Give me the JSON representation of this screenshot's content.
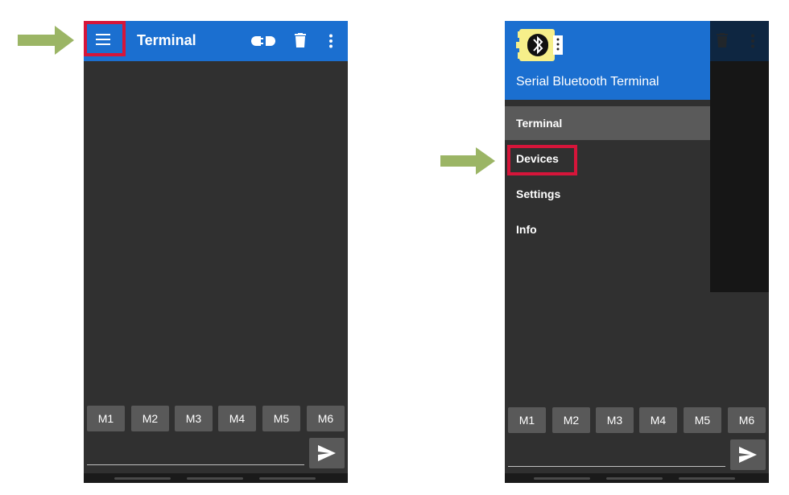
{
  "left_screen": {
    "appbar": {
      "title": "Terminal",
      "menu_icon": "hamburger-menu-icon",
      "connect_icon": "connect-icon",
      "delete_icon": "trash-icon",
      "overflow_icon": "more-vert-icon"
    },
    "macros": [
      "M1",
      "M2",
      "M3",
      "M4",
      "M5",
      "M6"
    ],
    "send_icon": "send-icon"
  },
  "right_screen": {
    "drawer": {
      "app_name": "Serial Bluetooth Terminal",
      "logo_icon": "bluetooth-serial-logo-icon",
      "items": [
        {
          "label": "Terminal",
          "active": true
        },
        {
          "label": "Devices",
          "active": false
        },
        {
          "label": "Settings",
          "active": false
        },
        {
          "label": "Info",
          "active": false
        }
      ]
    },
    "macros": [
      "M1",
      "M2",
      "M3",
      "M4",
      "M5",
      "M6"
    ],
    "send_icon": "send-icon"
  },
  "colors": {
    "appbar": "#1b6fd0",
    "background": "#303030",
    "macro_button": "#595959",
    "highlight": "#d6153a",
    "arrow": "#9bb565"
  }
}
